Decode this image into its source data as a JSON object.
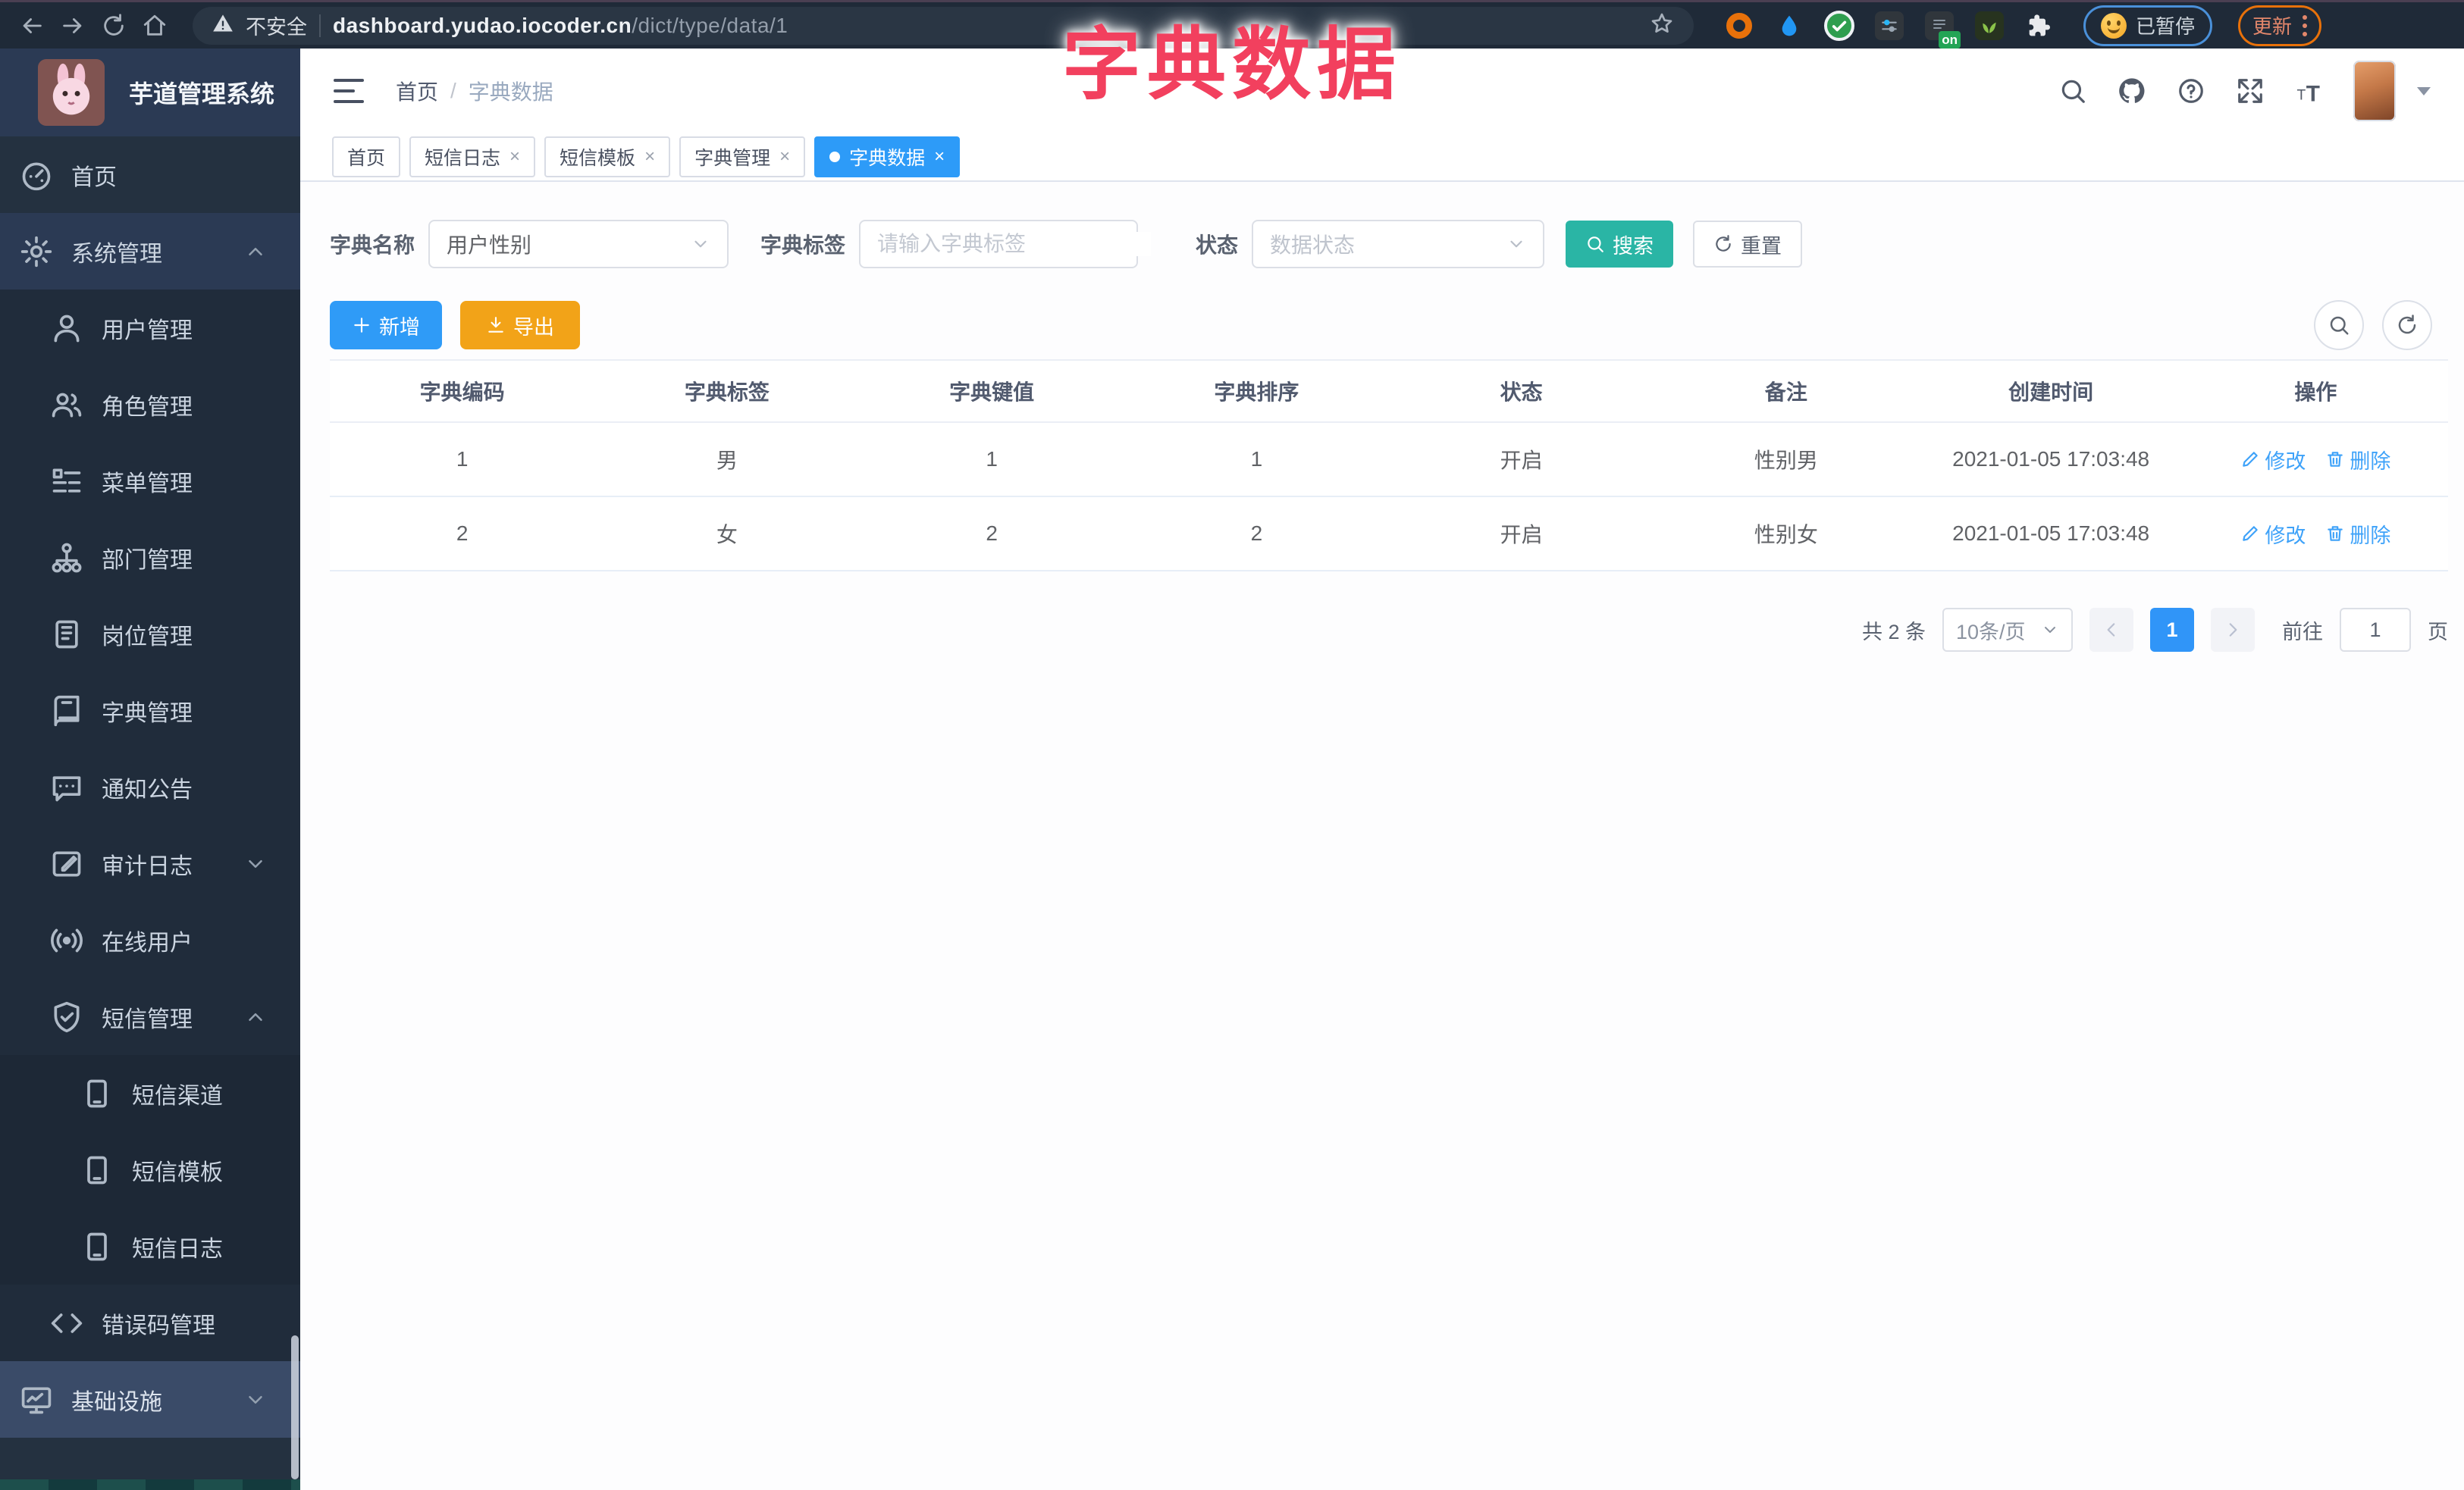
{
  "browser": {
    "security_label": "不安全",
    "url_domain": "dashboard.yudao.iocoder.cn",
    "url_path": "/dict/type/data/1",
    "ext_on_badge": "on",
    "paused_label": "已暂停",
    "update_label": "更新"
  },
  "overlay_title": "字典数据",
  "sidebar": {
    "app_title": "芋道管理系统",
    "items": [
      {
        "label": "首页"
      },
      {
        "label": "系统管理"
      },
      {
        "label": "用户管理"
      },
      {
        "label": "角色管理"
      },
      {
        "label": "菜单管理"
      },
      {
        "label": "部门管理"
      },
      {
        "label": "岗位管理"
      },
      {
        "label": "字典管理"
      },
      {
        "label": "通知公告"
      },
      {
        "label": "审计日志"
      },
      {
        "label": "在线用户"
      },
      {
        "label": "短信管理"
      },
      {
        "label": "短信渠道"
      },
      {
        "label": "短信模板"
      },
      {
        "label": "短信日志"
      },
      {
        "label": "错误码管理"
      },
      {
        "label": "基础设施"
      }
    ]
  },
  "header": {
    "breadcrumb": {
      "home": "首页",
      "sep": "/",
      "current": "字典数据"
    }
  },
  "tabs": [
    {
      "label": "首页"
    },
    {
      "label": "短信日志"
    },
    {
      "label": "短信模板"
    },
    {
      "label": "字典管理"
    },
    {
      "label": "字典数据"
    }
  ],
  "ui": {
    "close_glyph": "×"
  },
  "filter": {
    "dict_name_label": "字典名称",
    "dict_name_value": "用户性别",
    "dict_label_label": "字典标签",
    "dict_label_placeholder": "请输入字典标签",
    "status_label": "状态",
    "status_placeholder": "数据状态",
    "search_label": "搜索",
    "reset_label": "重置"
  },
  "toolbar": {
    "add_label": "新增",
    "export_label": "导出"
  },
  "table": {
    "headers": [
      "字典编码",
      "字典标签",
      "字典键值",
      "字典排序",
      "状态",
      "备注",
      "创建时间",
      "操作"
    ],
    "rows": [
      {
        "code": "1",
        "label": "男",
        "value": "1",
        "sort": "1",
        "status": "开启",
        "remark": "性别男",
        "created": "2021-01-05 17:03:48",
        "edit": "修改",
        "delete": "删除"
      },
      {
        "code": "2",
        "label": "女",
        "value": "2",
        "sort": "2",
        "status": "开启",
        "remark": "性别女",
        "created": "2021-01-05 17:03:48",
        "edit": "修改",
        "delete": "删除"
      }
    ]
  },
  "pagination": {
    "total": "共 2 条",
    "page_size": "10条/页",
    "page": "1",
    "goto_label": "前往",
    "goto_value": "1",
    "page_unit": "页"
  },
  "colors": {
    "accent_blue": "#2f9bf7",
    "teal_search": "#2ab5a5",
    "warning_orange": "#f2a318",
    "overlay_pink": "#f2405e",
    "sidebar_dark": "#243140"
  }
}
